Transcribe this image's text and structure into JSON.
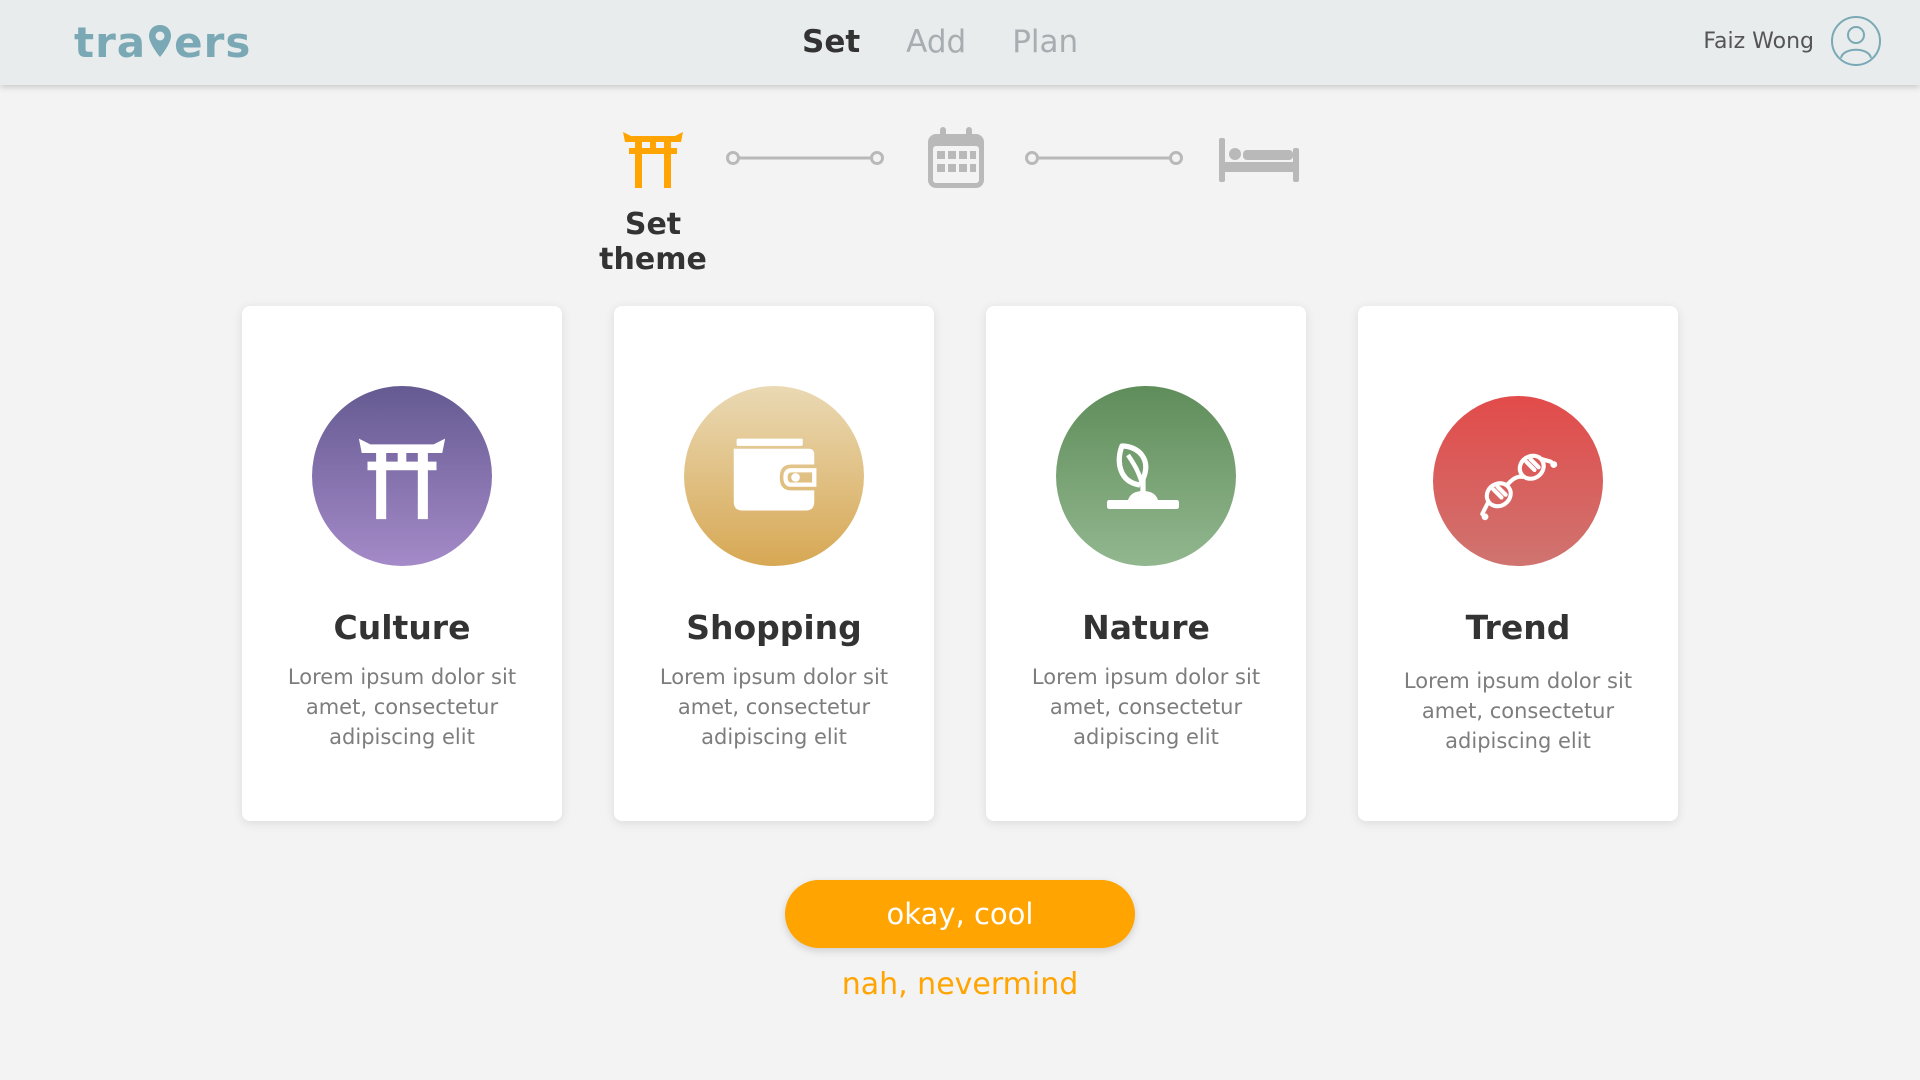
{
  "header": {
    "logo_left": "tra",
    "logo_right": "ers",
    "nav": [
      {
        "label": "Set",
        "active": true
      },
      {
        "label": "Add",
        "active": false
      },
      {
        "label": "Plan",
        "active": false
      }
    ],
    "user_name": "Faiz Wong",
    "avatar_icon": "user-icon"
  },
  "stepper": {
    "current_label": "Set theme",
    "steps": [
      {
        "icon": "torii-gate-icon",
        "state": "active"
      },
      {
        "icon": "calendar-icon",
        "state": "inactive"
      },
      {
        "icon": "bed-icon",
        "state": "inactive"
      }
    ]
  },
  "themes": [
    {
      "title": "Culture",
      "description": "Lorem ipsum dolor sit amet, consectetur adipiscing elit",
      "icon": "torii-gate-icon"
    },
    {
      "title": "Shopping",
      "description": "Lorem ipsum dolor sit amet, consectetur adipiscing elit",
      "icon": "wallet-icon"
    },
    {
      "title": "Nature",
      "description": "Lorem ipsum dolor sit amet, consectetur adipiscing elit",
      "icon": "sprout-icon"
    },
    {
      "title": "Trend",
      "description": "Lorem ipsum dolor sit amet, consectetur adipiscing elit",
      "icon": "sunglasses-icon"
    }
  ],
  "actions": {
    "confirm_label": "okay, cool",
    "cancel_label": "nah, nevermind"
  },
  "colors": {
    "accent": "#ffa400",
    "logo": "#7aa9b5",
    "inactive_step": "#b9b9b9"
  }
}
